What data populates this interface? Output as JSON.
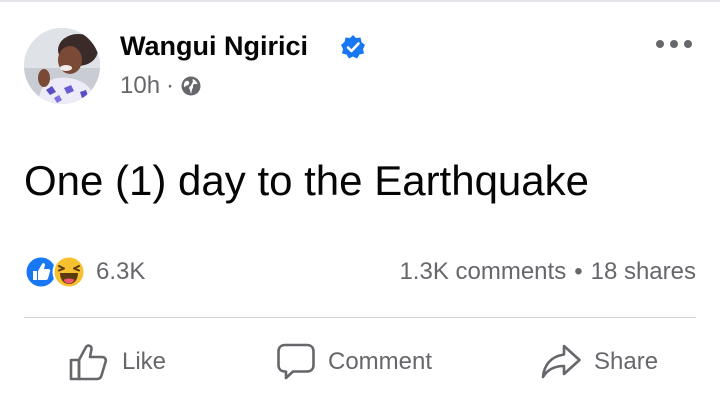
{
  "post": {
    "author": {
      "name": "Wangui Ngirici",
      "verified_icon": "verified-badge-icon",
      "avatar": "profile-photo"
    },
    "meta": {
      "time": "10h",
      "separator": "·",
      "audience_icon": "globe-icon"
    },
    "menu_icon": "more-options-icon",
    "text": "One (1) day to the Earthquake",
    "reactions": {
      "icons": [
        "like-reaction-icon",
        "haha-reaction-icon"
      ],
      "count": "6.3K"
    },
    "engagement": {
      "comments": "1.3K comments",
      "dot": "•",
      "shares": "18 shares"
    },
    "actions": {
      "like_label": "Like",
      "comment_label": "Comment",
      "share_label": "Share"
    }
  },
  "colors": {
    "primary_text": "#050505",
    "secondary_text": "#65676b",
    "accent_blue": "#1877f2",
    "divider": "#ced0d4"
  }
}
